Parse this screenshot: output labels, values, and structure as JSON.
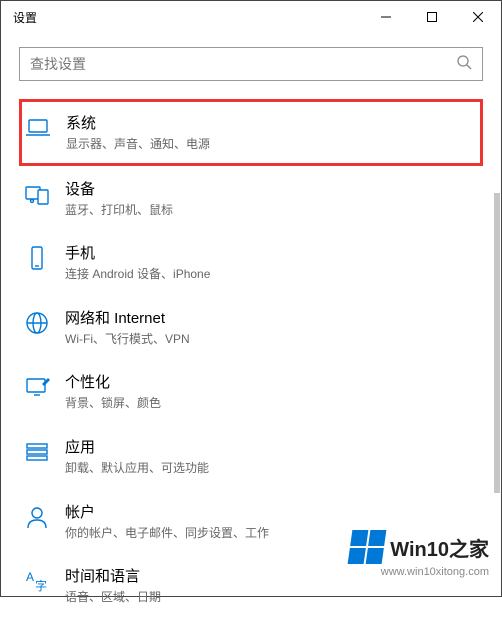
{
  "window": {
    "title": "设置"
  },
  "search": {
    "placeholder": "查找设置"
  },
  "categories": [
    {
      "title": "系统",
      "desc": "显示器、声音、通知、电源",
      "icon": "laptop",
      "highlighted": true
    },
    {
      "title": "设备",
      "desc": "蓝牙、打印机、鼠标",
      "icon": "devices",
      "highlighted": false
    },
    {
      "title": "手机",
      "desc": "连接 Android 设备、iPhone",
      "icon": "phone",
      "highlighted": false
    },
    {
      "title": "网络和 Internet",
      "desc": "Wi-Fi、飞行模式、VPN",
      "icon": "globe",
      "highlighted": false
    },
    {
      "title": "个性化",
      "desc": "背景、锁屏、颜色",
      "icon": "personalize",
      "highlighted": false
    },
    {
      "title": "应用",
      "desc": "卸载、默认应用、可选功能",
      "icon": "apps",
      "highlighted": false
    },
    {
      "title": "帐户",
      "desc": "你的帐户、电子邮件、同步设置、工作",
      "icon": "account",
      "highlighted": false
    },
    {
      "title": "时间和语言",
      "desc": "语音、区域、日期",
      "icon": "time-language",
      "highlighted": false
    }
  ],
  "watermark": {
    "brand_prefix": "Win10",
    "brand_suffix": "之家",
    "url": "www.win10xitong.com"
  }
}
